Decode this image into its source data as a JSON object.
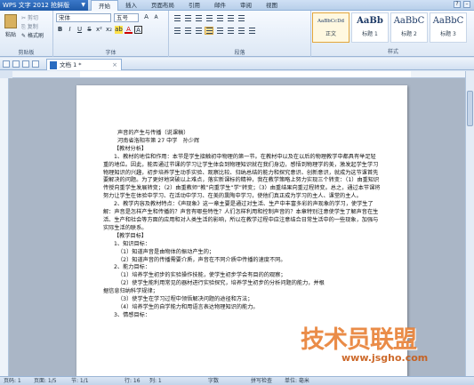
{
  "app": {
    "menu_label": "WPS 文字 2012 抢鲜版"
  },
  "tabs": [
    "开始",
    "插入",
    "页面布局",
    "引用",
    "邮件",
    "审阅",
    "视图"
  ],
  "ribbon": {
    "clipboard": {
      "paste": "粘贴",
      "cut": "剪切",
      "copy": "复制",
      "format_painter": "格式刷",
      "group": "剪贴板"
    },
    "font": {
      "name": "宋体",
      "size": "五号",
      "group": "字体"
    },
    "paragraph": {
      "group": "段落"
    },
    "styles": {
      "items": [
        {
          "sample": "AaBbCcDd",
          "name": "正文"
        },
        {
          "sample": "AaBb",
          "name": "标题 1"
        },
        {
          "sample": "AaBbC",
          "name": "标题 2"
        },
        {
          "sample": "AaBbC",
          "name": "标题 3"
        }
      ],
      "group": "样式"
    }
  },
  "document_tab": {
    "name": "文档 1 *"
  },
  "doc": {
    "title": "声音的产生与传播（说课稿）",
    "author": "河南省洛阳市第 27 中学　孙少辉",
    "sec1": "【教材分析】",
    "p1": "1、教材的地位和作用：本节是学生接触初中物理的第一节。在教材中以及在以后的物理教学中都具有举足轻重的地位。因此，能否通过节课的学习让学生体会到物理知识就在我们身边，感悟到物理学的美，激发起学生学习物理知识的兴趣，初步培养学生动手实验、观察比较、归纳总结的能力和探究意识、创新意识，就成为这节课首先要解决的问题。为了更好地突破以上难点，落实新课标的精神，我在教学策略上努力实现三个转变：（1）由重知识传授向重学生发展转变；（2）由重教师“教”向重学生“学”转变；（3）由重结果向重过程转变。总之，通过本节课将努力让学生在体验中学习、在活动中学习、在美的熏陶中学习，使他们真正成为学习的主人、课堂的主人。",
    "p2": "2、教学内容及教材特点：《声现象》这一章主要是通过对生活、生产中丰富多彩的声现象的学习，使学生了解：声音是怎样产生和传播的？声音有哪些特性？人们怎样利用和控制声音的？本章特别注意使学生了解声音在生活、生产和社会等方面的应用和对人类生活的影响，所以在教学过程中应注意结合日常生活中的一些现象，加强与实际生活的联系。",
    "sec2": "【教学目标】",
    "o1": "1、知识目标：",
    "o1a": "（1）知道声音是由物体的振动产生的；",
    "o1b": "（2）知道声音的传播需要介质，声音在不同介质中传播的速度不同。",
    "o2": "2、能力目标：",
    "o2a": "（1）培养学生初步的实验操作技能，使学生初步学会有目的的观察；",
    "o2b": "（2）使学生能利用常见的器材进行实验探究，培养学生初步的分析问题的能力，并根",
    "o2c": "据信息归纳科学规律；",
    "o2d": "（3）使学生在学习过程中领悟解决问题的途径和方法；",
    "o2e": "（4）培养学生的自学能力和用语言表达物理知识的能力。",
    "o3": "3、情感目标："
  },
  "watermark": {
    "logo": "技术员联盟",
    "url": "www.jsgho.com"
  },
  "status": {
    "page": "页码: 1",
    "pages": "页面: 1/5",
    "section": "节: 1/1",
    "line": "行: 16",
    "column": "列: 1",
    "chars": "字数",
    "spell": "拼写检查",
    "unit": "单位: 毫米"
  }
}
